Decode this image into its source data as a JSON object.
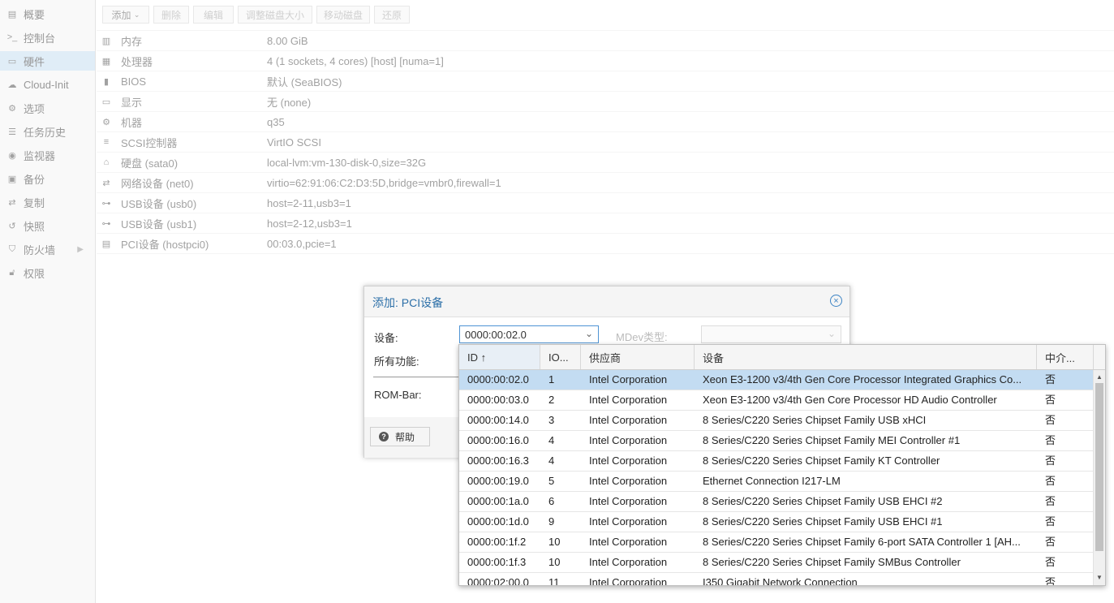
{
  "sidebar": {
    "items": [
      {
        "label": "概要",
        "icon": "book-icon",
        "active": false
      },
      {
        "label": "控制台",
        "icon": "terminal-icon",
        "active": false
      },
      {
        "label": "硬件",
        "icon": "monitor-icon",
        "active": true
      },
      {
        "label": "Cloud-Init",
        "icon": "cloud-icon",
        "active": false
      },
      {
        "label": "选项",
        "icon": "gear-icon",
        "active": false
      },
      {
        "label": "任务历史",
        "icon": "list-icon",
        "active": false
      },
      {
        "label": "监视器",
        "icon": "eye-icon",
        "active": false
      },
      {
        "label": "备份",
        "icon": "floppy-icon",
        "active": false
      },
      {
        "label": "复制",
        "icon": "retweet-icon",
        "active": false
      },
      {
        "label": "快照",
        "icon": "history-icon",
        "active": false
      },
      {
        "label": "防火墙",
        "icon": "shield-icon",
        "active": false
      },
      {
        "label": "权限",
        "icon": "unlock-icon",
        "active": false
      }
    ]
  },
  "toolbar": {
    "add_label": "添加",
    "remove_label": "删除",
    "edit_label": "编辑",
    "resize_label": "调整磁盘大小",
    "move_label": "移动磁盘",
    "revert_label": "还原"
  },
  "hardware": [
    {
      "key": "内存",
      "value": "8.00 GiB",
      "icon": "memory-icon"
    },
    {
      "key": "处理器",
      "value": "4 (1 sockets, 4 cores) [host] [numa=1]",
      "icon": "cpu-icon"
    },
    {
      "key": "BIOS",
      "value": "默认 (SeaBIOS)",
      "icon": "microchip-icon"
    },
    {
      "key": "显示",
      "value": "无 (none)",
      "icon": "desktop-icon"
    },
    {
      "key": "机器",
      "value": "q35",
      "icon": "cogs-icon"
    },
    {
      "key": "SCSI控制器",
      "value": "VirtIO SCSI",
      "icon": "database-icon"
    },
    {
      "key": "硬盘 (sata0)",
      "value": "local-lvm:vm-130-disk-0,size=32G",
      "icon": "hdd-icon"
    },
    {
      "key": "网络设备 (net0)",
      "value": "virtio=62:91:06:C2:D3:5D,bridge=vmbr0,firewall=1",
      "icon": "exchange-icon"
    },
    {
      "key": "USB设备 (usb0)",
      "value": "host=2-11,usb3=1",
      "icon": "usb-icon"
    },
    {
      "key": "USB设备 (usb1)",
      "value": "host=2-12,usb3=1",
      "icon": "usb-icon"
    },
    {
      "key": "PCI设备 (hostpci0)",
      "value": "00:03.0,pcie=1",
      "icon": "pci-card-icon"
    }
  ],
  "dialog": {
    "title": "添加: PCI设备",
    "device_label": "设备:",
    "device_value": "0000:00:02.0",
    "mdev_label": "MDev类型:",
    "all_functions_label": "所有功能:",
    "rom_bar_label": "ROM-Bar:",
    "help_label": "帮助"
  },
  "picker": {
    "columns": [
      "ID ↑",
      "IO...",
      "供应商",
      "设备",
      "中介..."
    ],
    "rows": [
      {
        "id": "0000:00:02.0",
        "iommu": "1",
        "vendor": "Intel Corporation",
        "device": "Xeon E3-1200 v3/4th Gen Core Processor Integrated Graphics Co...",
        "mdev": "否",
        "selected": true
      },
      {
        "id": "0000:00:03.0",
        "iommu": "2",
        "vendor": "Intel Corporation",
        "device": "Xeon E3-1200 v3/4th Gen Core Processor HD Audio Controller",
        "mdev": "否",
        "selected": false
      },
      {
        "id": "0000:00:14.0",
        "iommu": "3",
        "vendor": "Intel Corporation",
        "device": "8 Series/C220 Series Chipset Family USB xHCI",
        "mdev": "否",
        "selected": false
      },
      {
        "id": "0000:00:16.0",
        "iommu": "4",
        "vendor": "Intel Corporation",
        "device": "8 Series/C220 Series Chipset Family MEI Controller #1",
        "mdev": "否",
        "selected": false
      },
      {
        "id": "0000:00:16.3",
        "iommu": "4",
        "vendor": "Intel Corporation",
        "device": "8 Series/C220 Series Chipset Family KT Controller",
        "mdev": "否",
        "selected": false
      },
      {
        "id": "0000:00:19.0",
        "iommu": "5",
        "vendor": "Intel Corporation",
        "device": "Ethernet Connection I217-LM",
        "mdev": "否",
        "selected": false
      },
      {
        "id": "0000:00:1a.0",
        "iommu": "6",
        "vendor": "Intel Corporation",
        "device": "8 Series/C220 Series Chipset Family USB EHCI #2",
        "mdev": "否",
        "selected": false
      },
      {
        "id": "0000:00:1d.0",
        "iommu": "9",
        "vendor": "Intel Corporation",
        "device": "8 Series/C220 Series Chipset Family USB EHCI #1",
        "mdev": "否",
        "selected": false
      },
      {
        "id": "0000:00:1f.2",
        "iommu": "10",
        "vendor": "Intel Corporation",
        "device": "8 Series/C220 Series Chipset Family 6-port SATA Controller 1 [AH...",
        "mdev": "否",
        "selected": false
      },
      {
        "id": "0000:00:1f.3",
        "iommu": "10",
        "vendor": "Intel Corporation",
        "device": "8 Series/C220 Series Chipset Family SMBus Controller",
        "mdev": "否",
        "selected": false
      },
      {
        "id": "0000:02:00.0",
        "iommu": "11",
        "vendor": "Intel Corporation",
        "device": "I350 Gigabit Network Connection",
        "mdev": "否",
        "selected": false
      }
    ]
  }
}
